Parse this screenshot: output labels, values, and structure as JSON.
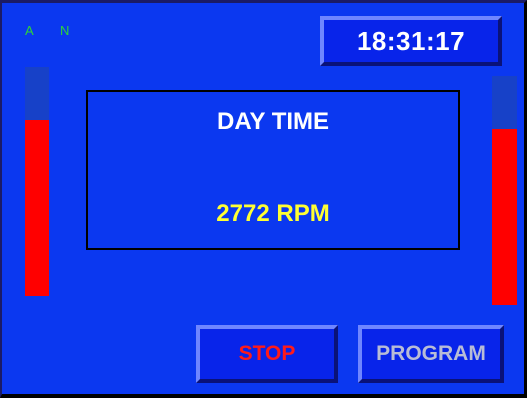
{
  "indicators": {
    "a_label": "A",
    "n_label": "N"
  },
  "clock": {
    "time": "18:31:17"
  },
  "display": {
    "title": "DAY TIME",
    "rpm_text": "2772 RPM"
  },
  "level_bars": {
    "left_fill_percent": 77,
    "right_fill_percent": 77,
    "fill_color": "#ff0000",
    "track_color": "#1741c8"
  },
  "buttons": {
    "stop_label": "STOP",
    "program_label": "PROGRAM"
  },
  "colors": {
    "background": "#0b38f0",
    "indicator": "#2fd33a",
    "rpm_text": "#ffff33",
    "stop_text": "#ff1a1a"
  }
}
